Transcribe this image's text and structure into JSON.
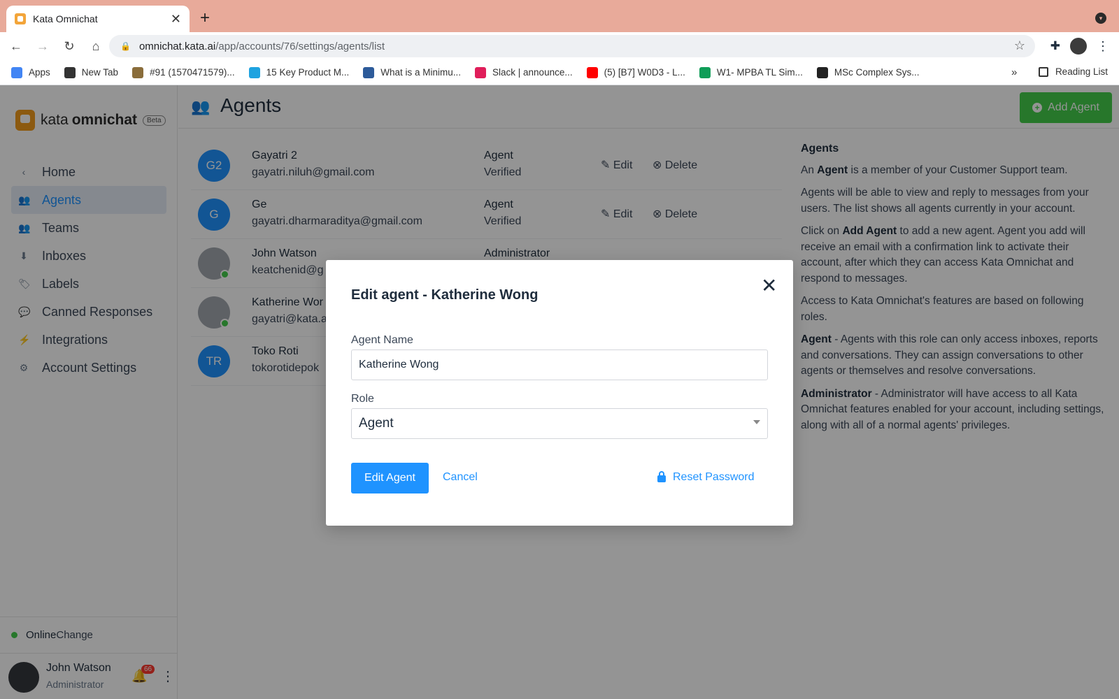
{
  "browser": {
    "tab_title": "Kata Omnichat",
    "tab_close": "✕",
    "new_tab": "+",
    "url_host": "omnichat.kata.ai",
    "url_path": "/app/accounts/76/settings/agents/list",
    "bookmarks": [
      {
        "label": "Apps",
        "color": "#4285f4"
      },
      {
        "label": "New Tab",
        "color": "#333333"
      },
      {
        "label": "#91 (1570471579)...",
        "color": "#8a6d3b"
      },
      {
        "label": "15 Key Product M...",
        "color": "#1fa3e0"
      },
      {
        "label": "What is a Minimu...",
        "color": "#2d5b9a"
      },
      {
        "label": "Slack | announce...",
        "color": "#e01e5a"
      },
      {
        "label": "(5) [B7] W0D3 - L...",
        "color": "#ff0000"
      },
      {
        "label": "W1- MPBA TL Sim...",
        "color": "#0f9d58"
      },
      {
        "label": "MSc Complex Sys...",
        "color": "#222222"
      }
    ],
    "bookmarks_more": "»",
    "reading_list": "Reading List"
  },
  "app": {
    "logo_word1": "kata",
    "logo_word2": "omnichat",
    "logo_badge": "Beta",
    "nav": [
      {
        "label": "Home",
        "icon": "chevron-left-icon",
        "glyph": "‹",
        "active": false
      },
      {
        "label": "Agents",
        "icon": "people-icon",
        "glyph": "👥",
        "active": true
      },
      {
        "label": "Teams",
        "icon": "team-icon",
        "glyph": "👥",
        "active": false
      },
      {
        "label": "Inboxes",
        "icon": "inbox-icon",
        "glyph": "⬇",
        "active": false
      },
      {
        "label": "Labels",
        "icon": "tag-icon",
        "glyph": "🏷",
        "active": false
      },
      {
        "label": "Canned Responses",
        "icon": "chat-icon",
        "glyph": "💬",
        "active": false
      },
      {
        "label": "Integrations",
        "icon": "bolt-icon",
        "glyph": "⚡",
        "active": false
      },
      {
        "label": "Account Settings",
        "icon": "gear-icon",
        "glyph": "⚙",
        "active": false
      }
    ],
    "status": {
      "label": "Online",
      "change": "Change"
    },
    "user": {
      "name": "John Watson",
      "role": "Administrator",
      "notifications": "66"
    }
  },
  "page": {
    "title": "Agents",
    "add_button": "Add Agent",
    "agents": [
      {
        "initials": "G2",
        "name": "Gayatri 2",
        "email": "gayatri.niluh@gmail.com",
        "role": "Agent",
        "status": "Verified",
        "edit": "Edit",
        "delete": "Delete",
        "photo": false,
        "online": false
      },
      {
        "initials": "G",
        "name": "Ge",
        "email": "gayatri.dharmaraditya@gmail.com",
        "role": "Agent",
        "status": "Verified",
        "edit": "Edit",
        "delete": "Delete",
        "photo": false,
        "online": false
      },
      {
        "initials": "",
        "name": "John Watson",
        "email": "keatchenid@g",
        "role": "Administrator",
        "status": "",
        "edit": "",
        "delete": "",
        "photo": true,
        "online": true
      },
      {
        "initials": "",
        "name": "Katherine Wor",
        "email": "gayatri@kata.a",
        "role": "",
        "status": "",
        "edit": "",
        "delete": "",
        "photo": true,
        "online": true
      },
      {
        "initials": "TR",
        "name": "Toko Roti",
        "email": "tokorotidepok",
        "role": "",
        "status": "",
        "edit": "",
        "delete": "",
        "photo": false,
        "online": false
      }
    ],
    "help": {
      "heading": "Agents",
      "p1_pre": "An ",
      "p1_bold": "Agent",
      "p1_post": " is a member of your Customer Support team.",
      "p2": "Agents will be able to view and reply to messages from your users. The list shows all agents currently in your account.",
      "p3_pre": "Click on ",
      "p3_bold": "Add Agent",
      "p3_post": " to add a new agent. Agent you add will receive an email with a confirmation link to activate their account, after which they can access Kata Omnichat and respond to messages.",
      "p4": "Access to Kata Omnichat's features are based on following roles.",
      "p5_bold": "Agent",
      "p5_post": " - Agents with this role can only access inboxes, reports and conversations. They can assign conversations to other agents or themselves and resolve conversations.",
      "p6_bold": "Administrator",
      "p6_post": " - Administrator will have access to all Kata Omnichat features enabled for your account, including settings, along with all of a normal agents' privileges."
    }
  },
  "modal": {
    "title": "Edit agent - Katherine Wong",
    "close": "✕",
    "name_label": "Agent Name",
    "name_value": "Katherine Wong",
    "role_label": "Role",
    "role_value": "Agent",
    "submit": "Edit Agent",
    "cancel": "Cancel",
    "reset": "Reset Password"
  }
}
